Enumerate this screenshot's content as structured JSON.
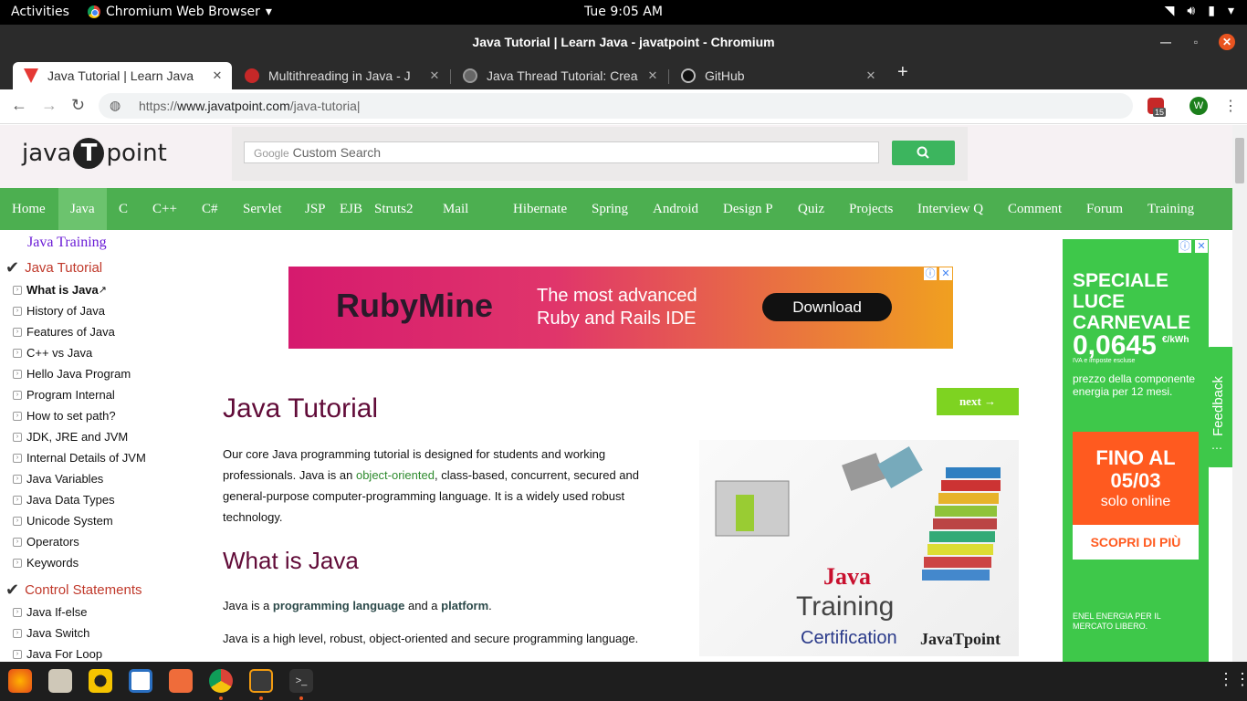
{
  "system": {
    "activities": "Activities",
    "app_name": "Chromium Web Browser",
    "clock": "Tue  9:05 AM"
  },
  "window": {
    "title": "Java Tutorial | Learn Java - javatpoint - Chromium"
  },
  "tabs": [
    {
      "label": "Java Tutorial | Learn Java",
      "active": true
    },
    {
      "label": "Multithreading in Java - J"
    },
    {
      "label": "Java Thread Tutorial: Crea"
    },
    {
      "label": "GitHub"
    }
  ],
  "omnibox": {
    "url_prefix": "https://",
    "url_domain": "www.javatpoint.com",
    "url_path": "/java-tutoria"
  },
  "extensions": {
    "abp_count": "15",
    "profile_initial": "W"
  },
  "site": {
    "logo_left": "java",
    "logo_t": "T",
    "logo_right": "point",
    "search_google": "Google",
    "search_placeholder": "Custom Search"
  },
  "nav": [
    "Home",
    "Java",
    "C",
    "C++",
    "C#",
    "Servlet",
    "JSP",
    "EJB",
    "Struts2",
    "Mail",
    "Hibernate",
    "Spring",
    "Android",
    "Design P",
    "Quiz",
    "Projects",
    "Interview Q",
    "Comment",
    "Forum",
    "Training"
  ],
  "sidebar": {
    "head": "Java Training",
    "section1": "Java Tutorial",
    "items1": [
      "What is Java",
      "History of Java",
      "Features of Java",
      "C++ vs Java",
      "Hello Java Program",
      "Program Internal",
      "How to set path?",
      "JDK, JRE and JVM",
      "Internal Details of JVM",
      "Java Variables",
      "Java Data Types",
      "Unicode System",
      "Operators",
      "Keywords"
    ],
    "section2": "Control Statements",
    "items2": [
      "Java If-else",
      "Java Switch",
      "Java For Loop"
    ]
  },
  "ad_ruby": {
    "brand": "RubyMine",
    "line1": "The most advanced",
    "line2": "Ruby and Rails IDE",
    "cta": "Download"
  },
  "article": {
    "h1": "Java Tutorial",
    "next": "next →",
    "p1a": "Our core Java programming tutorial is designed for students and working professionals. Java is an ",
    "p1link": "object-oriented",
    "p1b": ", class-based, concurrent, secured and general-purpose computer-programming language. It is a widely used robust technology.",
    "h2": "What is Java",
    "p2a": "Java is a ",
    "p2b1": "programming language",
    "p2c": " and a ",
    "p2b2": "platform",
    "p2d": ".",
    "p3": "Java is a high level, robust, object-oriented and secure programming language."
  },
  "java_image": {
    "logo": "Java",
    "training": "Training",
    "cert": "Certification",
    "brand": "JavaTpoint"
  },
  "ad_enel": {
    "t1": "SPECIALE LUCE CARNEVALE",
    "price": "0,0645",
    "unit": "€/kWh",
    "iva": "IVA e imposte escluse",
    "t2": "prezzo della componente energia per 12 mesi.",
    "o1": "FINO AL 05/03",
    "o2": "solo online",
    "cta": "SCOPRI DI PIÙ",
    "t3": "ENEL ENERGIA PER IL MERCATO LIBERO."
  },
  "feedback": "Feedback"
}
